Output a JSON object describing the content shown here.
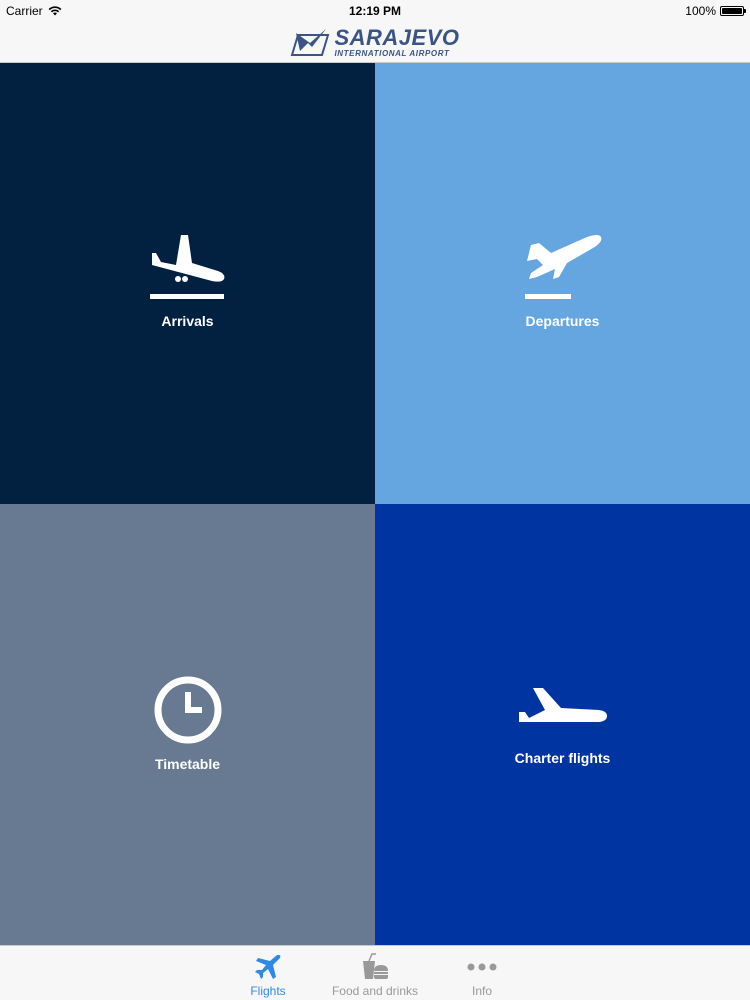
{
  "status_bar": {
    "carrier": "Carrier",
    "time": "12:19 PM",
    "battery": "100%",
    "battery_level": 1.0
  },
  "nav_bar": {
    "logo_title": "SARAJEVO",
    "logo_subtitle": "INTERNATIONAL AIRPORT"
  },
  "tiles": [
    {
      "label": "Arrivals",
      "icon": "plane-landing-icon",
      "color": "#02203f"
    },
    {
      "label": "Departures",
      "icon": "plane-takeoff-icon",
      "color": "#65a6e0"
    },
    {
      "label": "Timetable",
      "icon": "clock-icon",
      "color": "#687a92"
    },
    {
      "label": "Charter flights",
      "icon": "plane-icon",
      "color": "#0034a0"
    }
  ],
  "tab_bar": {
    "items": [
      {
        "label": "Flights",
        "icon": "plane-icon",
        "selected": true
      },
      {
        "label": "Food and drinks",
        "icon": "food-drink-icon",
        "selected": false
      },
      {
        "label": "Info",
        "icon": "more-dots-icon",
        "selected": false
      }
    ]
  },
  "colors": {
    "tab_active": "#2f8ae5",
    "tab_inactive": "#999999",
    "logo": "#3a5486"
  }
}
